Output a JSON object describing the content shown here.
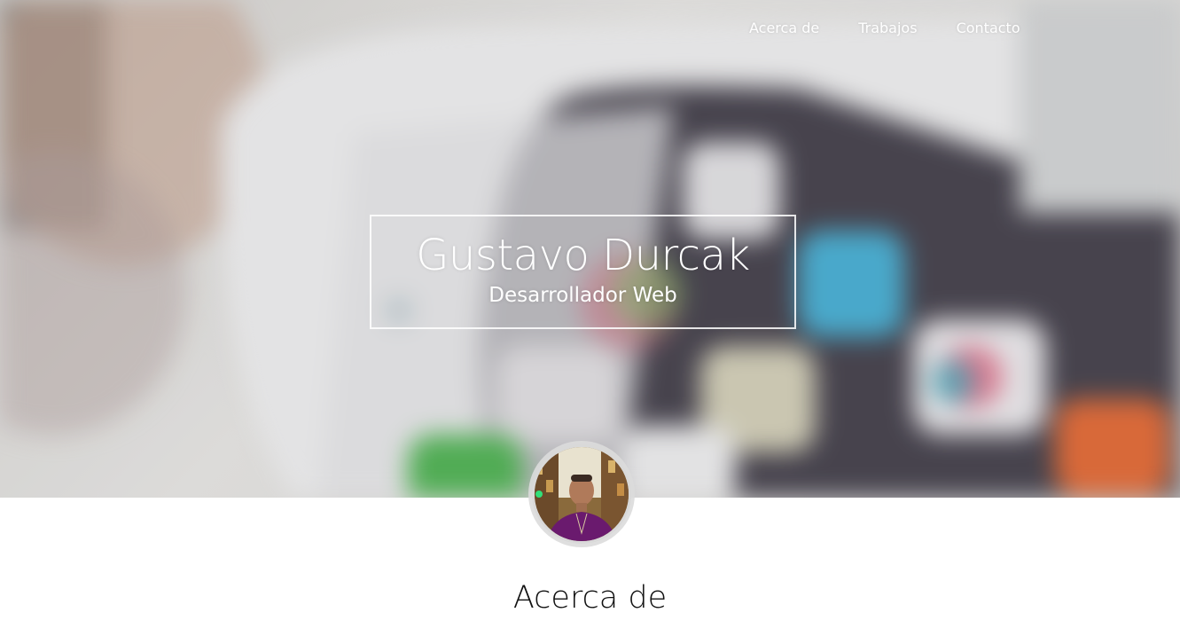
{
  "nav": {
    "items": [
      {
        "label": "Acerca de"
      },
      {
        "label": "Trabajos"
      },
      {
        "label": "Contacto"
      }
    ]
  },
  "hero": {
    "name": "Gustavo Durcak",
    "role": "Desarrollador Web",
    "text_color": "#ffffff"
  },
  "about": {
    "title": "Acerca de"
  }
}
